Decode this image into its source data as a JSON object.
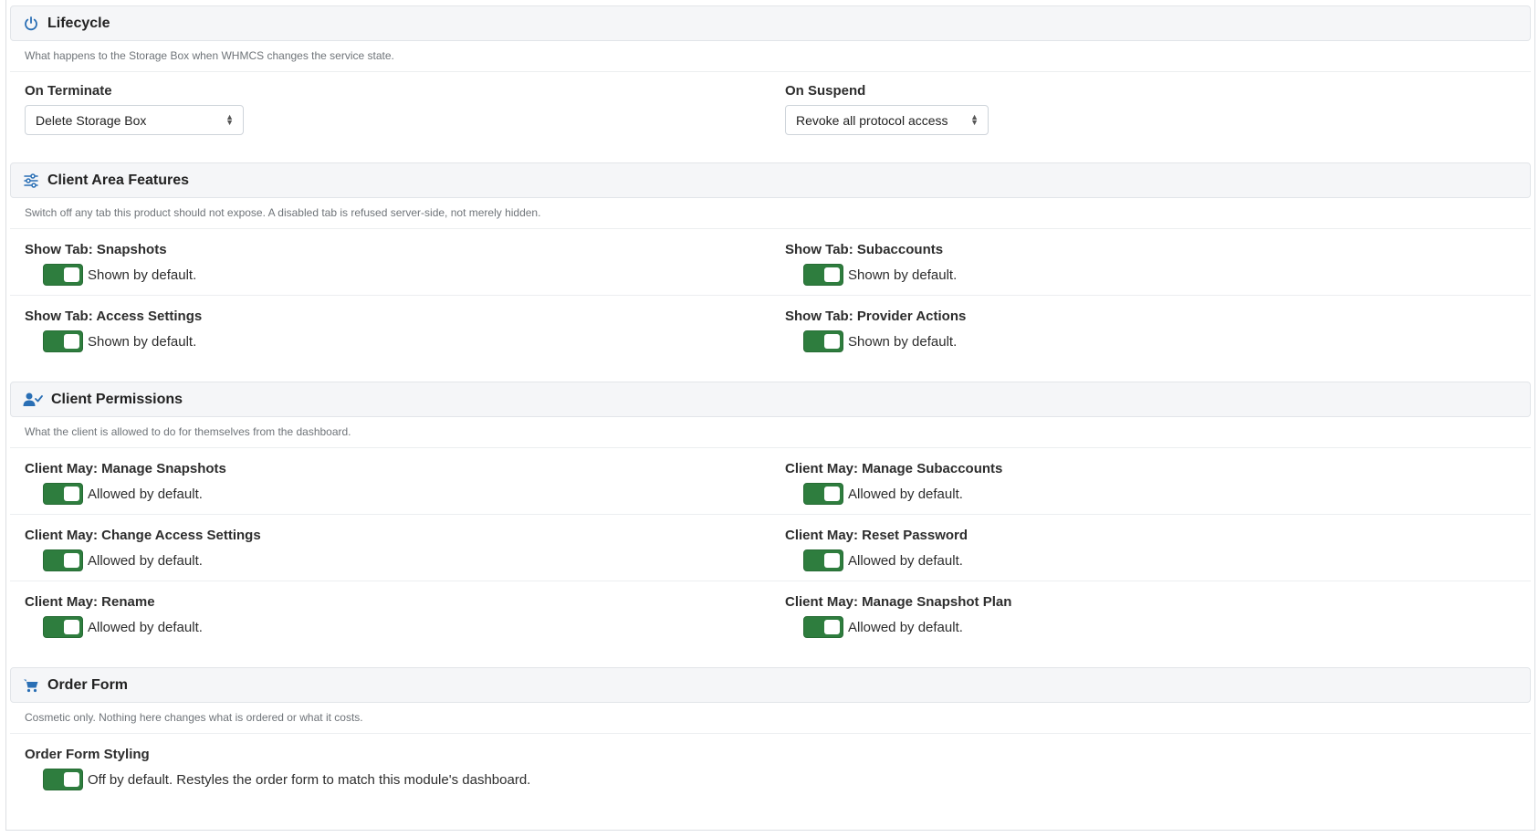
{
  "lifecycle": {
    "title": "Lifecycle",
    "description": "What happens to the Storage Box when WHMCS changes the service state.",
    "on_terminate": {
      "label": "On Terminate",
      "value": "Delete Storage Box"
    },
    "on_suspend": {
      "label": "On Suspend",
      "value": "Revoke all protocol access"
    }
  },
  "features": {
    "title": "Client Area Features",
    "description": "Switch off any tab this product should not expose. A disabled tab is refused server-side, not merely hidden.",
    "items": [
      {
        "label": "Show Tab: Snapshots",
        "text": "Shown by default.",
        "on": true
      },
      {
        "label": "Show Tab: Subaccounts",
        "text": "Shown by default.",
        "on": true
      },
      {
        "label": "Show Tab: Access Settings",
        "text": "Shown by default.",
        "on": true
      },
      {
        "label": "Show Tab: Provider Actions",
        "text": "Shown by default.",
        "on": true
      }
    ]
  },
  "permissions": {
    "title": "Client Permissions",
    "description": "What the client is allowed to do for themselves from the dashboard.",
    "items": [
      {
        "label": "Client May: Manage Snapshots",
        "text": "Allowed by default.",
        "on": true
      },
      {
        "label": "Client May: Manage Subaccounts",
        "text": "Allowed by default.",
        "on": true
      },
      {
        "label": "Client May: Change Access Settings",
        "text": "Allowed by default.",
        "on": true
      },
      {
        "label": "Client May: Reset Password",
        "text": "Allowed by default.",
        "on": true
      },
      {
        "label": "Client May: Rename",
        "text": "Allowed by default.",
        "on": true
      },
      {
        "label": "Client May: Manage Snapshot Plan",
        "text": "Allowed by default.",
        "on": true
      }
    ]
  },
  "order_form": {
    "title": "Order Form",
    "description": "Cosmetic only. Nothing here changes what is ordered or what it costs.",
    "styling": {
      "label": "Order Form Styling",
      "text": "Off by default. Restyles the order form to match this module's dashboard.",
      "on": true
    }
  },
  "colors": {
    "toggle_on": "#2e7d3e",
    "icon_accent": "#2a6fb5"
  },
  "icons": {
    "lifecycle": "power-icon",
    "features": "sliders-icon",
    "permissions": "user-check-icon",
    "order_form": "cart-icon"
  }
}
